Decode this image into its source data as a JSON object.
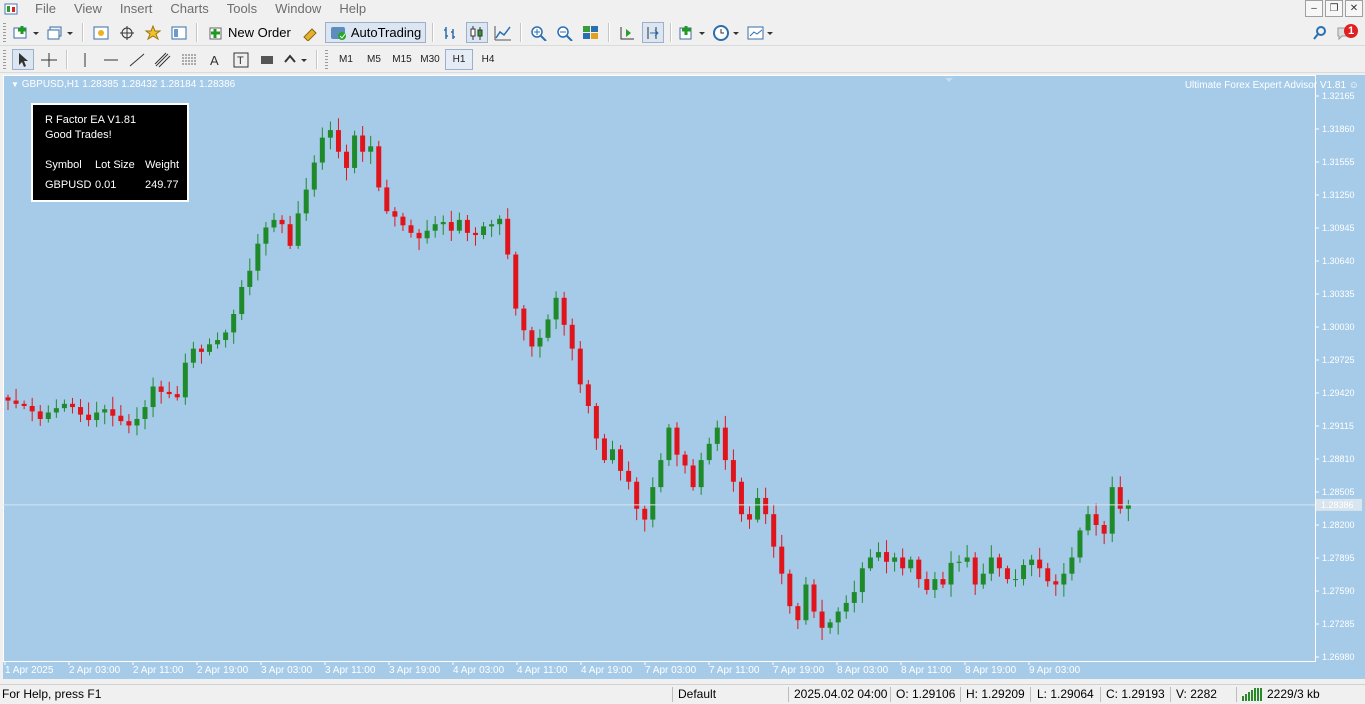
{
  "menu": [
    "File",
    "View",
    "Insert",
    "Charts",
    "Tools",
    "Window",
    "Help"
  ],
  "toolbar": {
    "new_order_label": "New Order",
    "autotrading_label": "AutoTrading"
  },
  "alerts_badge": "1",
  "timeframes": [
    "M1",
    "M5",
    "M15",
    "M30",
    "H1",
    "H4"
  ],
  "active_timeframe": "H1",
  "chart": {
    "title": "GBPUSD,H1  1.28385 1.28432 1.28184 1.28386",
    "ea_name": "Ultimate Forex Expert Advisor V1.81 ☺",
    "current_price_label": "1.28386",
    "price_axis": [
      "1.32165",
      "1.31860",
      "1.31555",
      "1.31250",
      "1.30945",
      "1.30640",
      "1.30335",
      "1.30030",
      "1.29725",
      "1.29420",
      "1.29115",
      "1.28810",
      "1.28505",
      "1.28200",
      "1.27895",
      "1.27590",
      "1.27285",
      "1.26980"
    ],
    "time_axis": [
      "1 Apr 2025",
      "2 Apr 03:00",
      "2 Apr 11:00",
      "2 Apr 19:00",
      "3 Apr 03:00",
      "3 Apr 11:00",
      "3 Apr 19:00",
      "4 Apr 03:00",
      "4 Apr 11:00",
      "4 Apr 19:00",
      "7 Apr 03:00",
      "7 Apr 11:00",
      "7 Apr 19:00",
      "8 Apr 03:00",
      "8 Apr 11:00",
      "8 Apr 19:00",
      "9 Apr 03:00"
    ]
  },
  "panel": {
    "line1": "R Factor EA V1.81",
    "line2": "Good Trades!",
    "headers": [
      "Symbol",
      "Lot Size",
      "Weight"
    ],
    "row": [
      "GBPUSD",
      "0.01",
      "249.77"
    ]
  },
  "status": {
    "help": "For Help, press F1",
    "profile": "Default",
    "datetime": "2025.04.02 04:00",
    "open": "O: 1.29106",
    "high": "H: 1.29209",
    "low": "L: 1.29064",
    "close": "C: 1.29193",
    "volume": "V: 2282",
    "traffic": "2229/3 kb"
  },
  "colors": {
    "chart_bg": "#a6cbe9",
    "bull": "#1f8a2a",
    "bear": "#e0141b",
    "axis_text": "#ffffff"
  },
  "chart_data": {
    "type": "candlestick",
    "symbol": "GBPUSD",
    "timeframe": "H1",
    "ylim": [
      1.2698,
      1.32165
    ],
    "closes": [
      1.2935,
      1.2932,
      1.293,
      1.2925,
      1.2918,
      1.2924,
      1.2928,
      1.2932,
      1.2929,
      1.2922,
      1.2917,
      1.2924,
      1.2927,
      1.2921,
      1.2916,
      1.2912,
      1.2918,
      1.2929,
      1.2948,
      1.2943,
      1.2941,
      1.2938,
      1.297,
      1.2983,
      1.298,
      1.2987,
      1.2991,
      1.2998,
      1.3015,
      1.304,
      1.3055,
      1.308,
      1.3095,
      1.3102,
      1.3098,
      1.3078,
      1.3108,
      1.313,
      1.3155,
      1.3178,
      1.3185,
      1.3165,
      1.315,
      1.318,
      1.3165,
      1.317,
      1.3132,
      1.311,
      1.3105,
      1.3097,
      1.309,
      1.3085,
      1.3092,
      1.3098,
      1.31,
      1.3092,
      1.3102,
      1.309,
      1.3088,
      1.3096,
      1.3098,
      1.3103,
      1.307,
      1.302,
      1.3,
      1.2985,
      1.2993,
      1.301,
      1.303,
      1.3005,
      1.2983,
      1.295,
      1.293,
      1.29,
      1.288,
      1.289,
      1.287,
      1.286,
      1.2835,
      1.2825,
      1.2855,
      1.288,
      1.291,
      1.2885,
      1.2875,
      1.2855,
      1.288,
      1.2895,
      1.291,
      1.288,
      1.286,
      1.283,
      1.2825,
      1.2845,
      1.283,
      1.28,
      1.2775,
      1.2745,
      1.2732,
      1.2765,
      1.274,
      1.2725,
      1.273,
      1.274,
      1.2748,
      1.2758,
      1.278,
      1.279,
      1.2795,
      1.2786,
      1.279,
      1.278,
      1.2788,
      1.277,
      1.276,
      1.277,
      1.2765,
      1.2785,
      1.2786,
      1.279,
      1.2765,
      1.2775,
      1.279,
      1.278,
      1.277,
      1.277,
      1.2783,
      1.2788,
      1.278,
      1.2768,
      1.2765,
      1.2775,
      1.279,
      1.2815,
      1.283,
      1.282,
      1.2812,
      1.2855,
      1.2835,
      1.2839
    ]
  }
}
